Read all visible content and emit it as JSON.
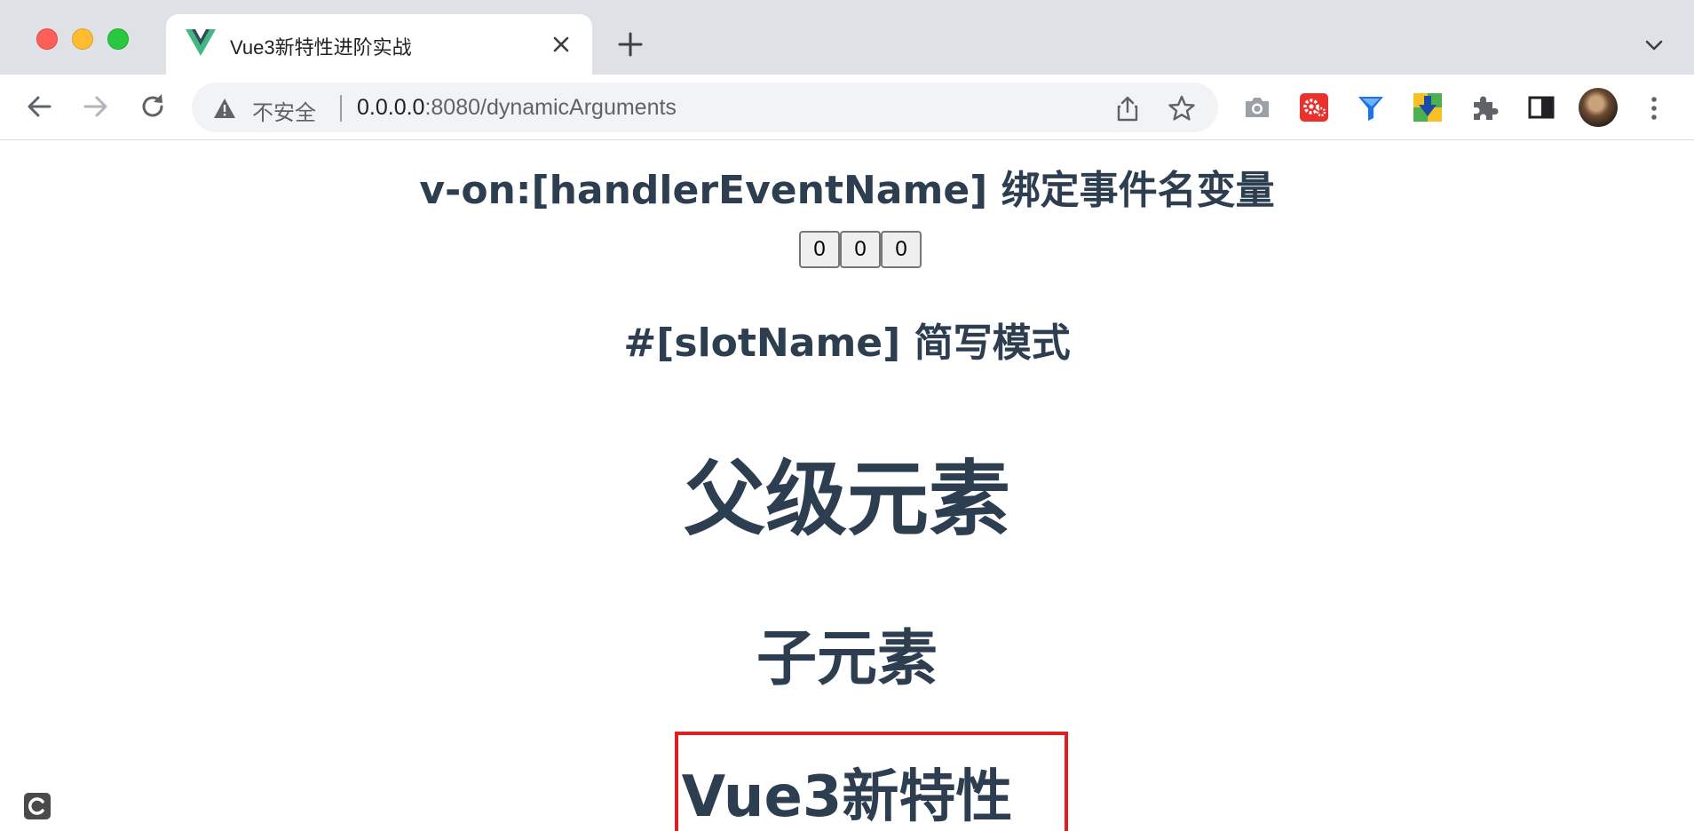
{
  "browser": {
    "tab": {
      "title": "Vue3新特性进阶实战",
      "favicon": "vue-logo-icon"
    },
    "omnibox": {
      "security_label": "不安全",
      "url_host": "0.0.0.0",
      "url_rest": ":8080/dynamicArguments"
    },
    "extensions": [
      "camera-icon",
      "red-gear-extension-icon",
      "blue-funnel-extension-icon",
      "download-arrow-extension-icon",
      "puzzle-icon",
      "side-panel-icon"
    ]
  },
  "page": {
    "events_heading": "v-on:[handlerEventName] 绑定事件名变量",
    "counter_buttons": [
      "0",
      "0",
      "0"
    ],
    "slot_heading": "#[slotName] 简写模式",
    "parent_heading": "父级元素",
    "child_heading": "子元素",
    "slot_content": "Vue3新特性"
  },
  "colors": {
    "heading_text": "#2c3e50",
    "slot_border": "#e02020",
    "chrome_frame": "#dee1e6"
  }
}
